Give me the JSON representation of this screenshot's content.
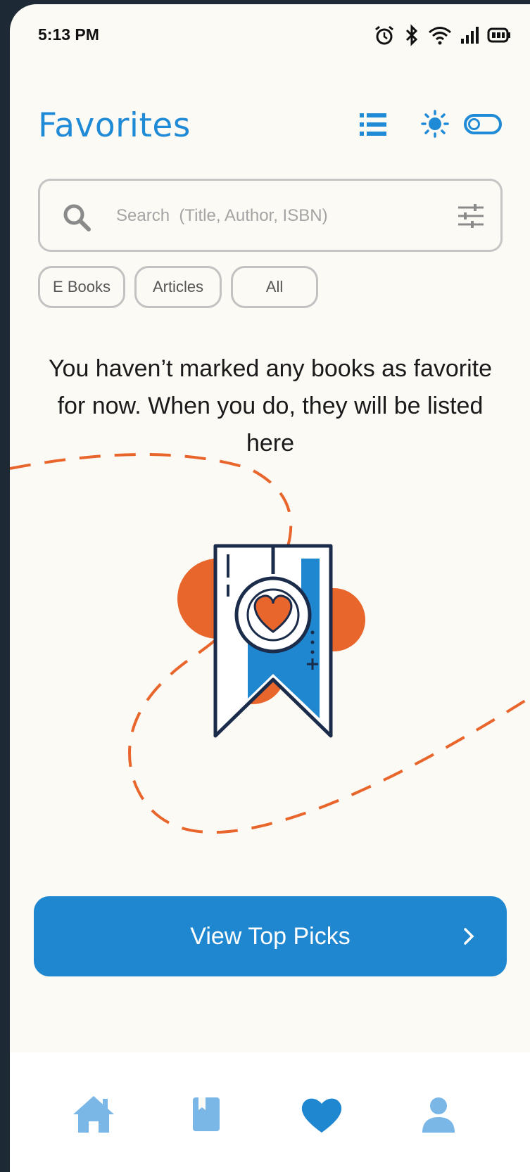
{
  "status_bar": {
    "time": "5:13 PM"
  },
  "header": {
    "title": "Favorites"
  },
  "search": {
    "placeholder": "Search  (Title, Author, ISBN)"
  },
  "filters": [
    {
      "label": "E Books"
    },
    {
      "label": "Articles"
    },
    {
      "label": "All"
    }
  ],
  "empty_state": {
    "message": "You haven’t marked any books as favorite for now. When you do, they will be listed here"
  },
  "cta": {
    "label": "View Top Picks"
  },
  "colors": {
    "accent": "#1f86d0",
    "illustration_orange": "#e8652b",
    "navy": "#1b2b4a",
    "background": "#fcfaf5"
  },
  "bottom_nav": {
    "items": [
      {
        "icon": "home-icon",
        "active": false
      },
      {
        "icon": "book-icon",
        "active": false
      },
      {
        "icon": "heart-icon",
        "active": true
      },
      {
        "icon": "profile-icon",
        "active": false
      }
    ]
  }
}
